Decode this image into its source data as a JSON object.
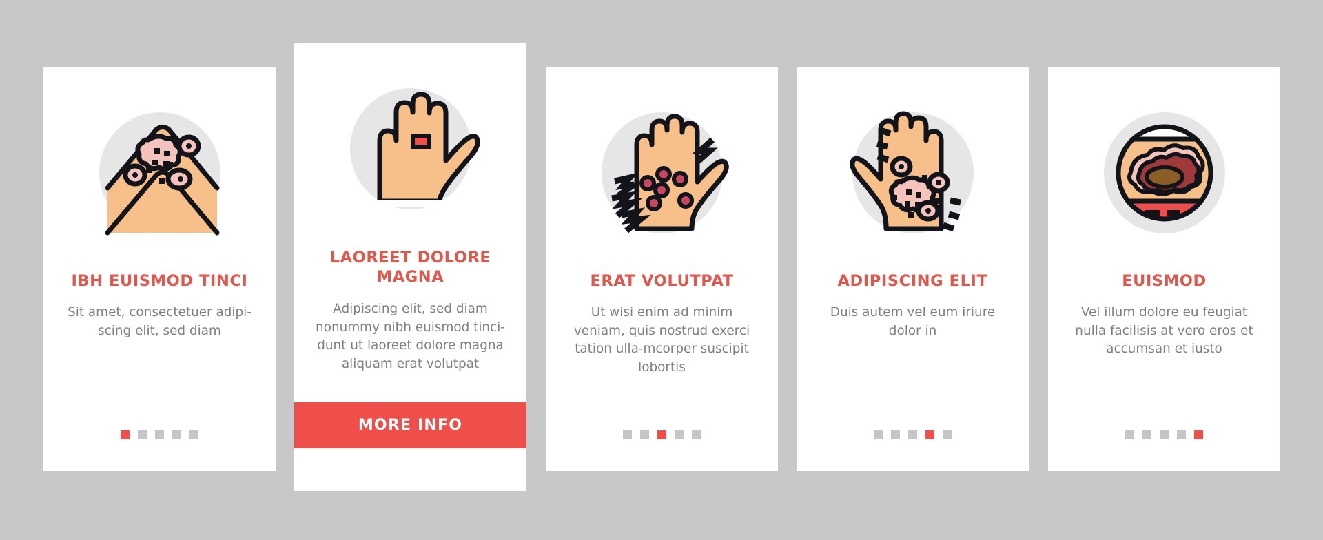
{
  "theme": {
    "page_background": "#c8c8c8",
    "card_background": "#ffffff",
    "accent": "#ef4f4b",
    "title_color": "#e2574c",
    "body_text_color": "#808080",
    "icon_circle": "#e6e6e6",
    "skin": "#f7c08a",
    "lesion_pink": "#f4c3bb",
    "dot_inactive": "#c6c6c6",
    "outline": "#12141a"
  },
  "cards": [
    {
      "icon_name": "skin-fold-lesions-icon",
      "title": "IBH EUISMOD TINCI",
      "body": "Sit amet, consectetuer adipi-scing elit, sed diam",
      "dots_total": 5,
      "dots_active_index": 0,
      "has_cta": false
    },
    {
      "icon_name": "hand-with-red-band-icon",
      "title": "LAOREET DOLORE MAGNA",
      "body": "Adipiscing elit, sed diam nonummy nibh euismod tinci-dunt ut laoreet dolore magna aliquam erat volutpat",
      "dots_total": 0,
      "dots_active_index": -1,
      "has_cta": true,
      "cta_label": "MORE INFO"
    },
    {
      "icon_name": "hand-itching-spots-icon",
      "title": "ERAT VOLUTPAT",
      "body": "Ut wisi enim ad minim veniam, quis nostrud exerci tation ulla-mcorper suscipit lobortis",
      "dots_total": 5,
      "dots_active_index": 2,
      "has_cta": false
    },
    {
      "icon_name": "hand-rash-patches-icon",
      "title": "ADIPISCING ELIT",
      "body": "Duis autem vel eum iriure dolor in",
      "dots_total": 5,
      "dots_active_index": 3,
      "has_cta": false
    },
    {
      "icon_name": "skin-cross-section-lesion-icon",
      "title": "EUISMOD",
      "body": "Vel illum dolore eu feugiat nulla facilisis at vero eros et accumsan et iusto",
      "dots_total": 5,
      "dots_active_index": 4,
      "has_cta": false
    }
  ]
}
